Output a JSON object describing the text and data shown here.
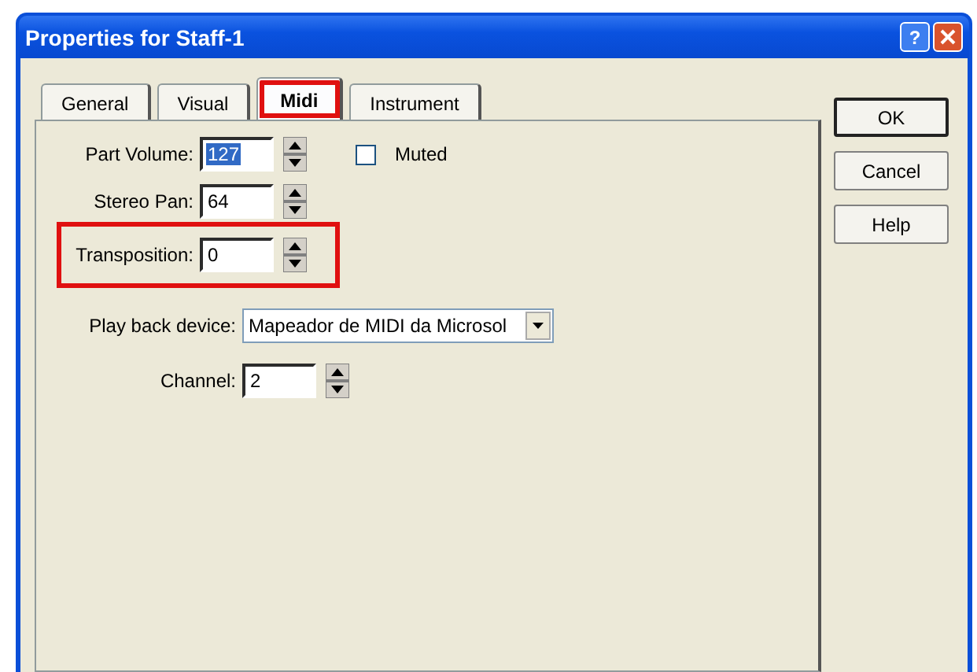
{
  "window": {
    "title": "Properties for Staff-1",
    "help_button": "?"
  },
  "tabs": [
    {
      "label": "General",
      "selected": false,
      "highlighted": false
    },
    {
      "label": "Visual",
      "selected": false,
      "highlighted": false
    },
    {
      "label": "Midi",
      "selected": true,
      "highlighted": true
    },
    {
      "label": "Instrument",
      "selected": false,
      "highlighted": false
    }
  ],
  "fields": [
    {
      "kind": "spin",
      "label": "Part Volume:",
      "value": "127",
      "text_selected": true
    },
    {
      "kind": "spin",
      "label": "Stereo Pan:",
      "value": "64"
    },
    {
      "kind": "spin",
      "label": "Transposition:",
      "value": "0",
      "highlighted": true
    },
    {
      "kind": "select",
      "label": "Play back device:",
      "value": "Mapeador de MIDI da Microsol"
    },
    {
      "kind": "spin",
      "label": "Channel:",
      "value": "2"
    }
  ],
  "muted": {
    "label": "Muted",
    "checked": false
  },
  "buttons": [
    {
      "label": "OK",
      "default": true
    },
    {
      "label": "Cancel",
      "default": false
    },
    {
      "label": "Help",
      "default": false
    }
  ]
}
